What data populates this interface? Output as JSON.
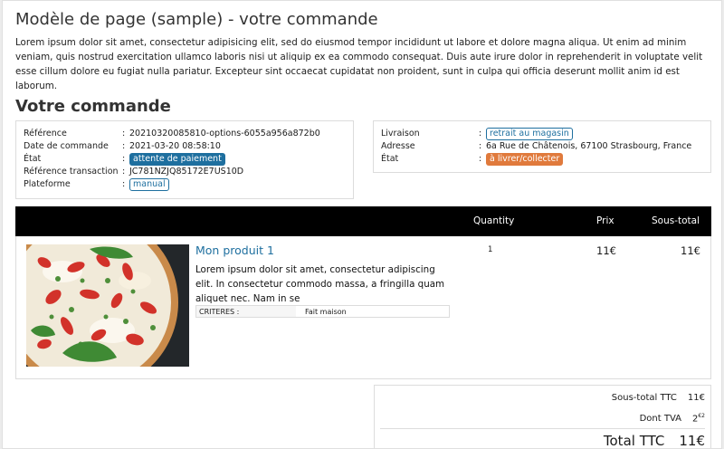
{
  "page": {
    "title": "Modèle de page (sample) - votre commande",
    "intro": "Lorem ipsum dolor sit amet, consectetur adipisicing elit, sed do eiusmod tempor incididunt ut labore et dolore magna aliqua. Ut enim ad minim veniam, quis nostrud exercitation ullamco laboris nisi ut aliquip ex ea commodo consequat. Duis aute irure dolor in reprehenderit in voluptate velit esse cillum dolore eu fugiat nulla pariatur. Excepteur sint occaecat cupidatat non proident, sunt in culpa qui officia deserunt mollit anim id est laborum."
  },
  "order": {
    "section_title": "Votre commande",
    "separator": ":",
    "left": {
      "reference_label": "Référence",
      "reference_value": "20210320085810-options-6055a956a872b0",
      "date_label": "Date de commande",
      "date_value": "2021-03-20 08:58:10",
      "state_label": "État",
      "state_value": "attente de paiement",
      "transaction_label": "Référence transaction",
      "transaction_value": "JC781NZJQ85172E7US10D",
      "platform_label": "Plateforme",
      "platform_value": "manual"
    },
    "right": {
      "delivery_label": "Livraison",
      "delivery_value": "retrait au magasin",
      "address_label": "Adresse",
      "address_value": "6a Rue de Châtenois, 67100 Strasbourg, France",
      "state_label": "État",
      "state_value": "à livrer/collecter"
    }
  },
  "table": {
    "headers": {
      "quantity": "Quantity",
      "price": "Prix",
      "subtotal": "Sous-total"
    },
    "items": [
      {
        "name": "Mon produit 1",
        "image_icon": "pizza-image",
        "description": "Lorem ipsum dolor sit amet, consectetur adipiscing elit. In consectetur commodo massa, a fringilla quam aliquet nec. Nam in se",
        "criteria_label": "CRITERES :",
        "criteria_value": "Fait maison",
        "quantity": "1",
        "price": "11€",
        "subtotal": "11€"
      }
    ]
  },
  "totals": {
    "subtotal_label": "Sous-total TTC",
    "subtotal_value": "11€",
    "tax_label": "Dont TVA",
    "tax_value": "2",
    "tax_value_cents": "€2",
    "total_label": "Total TTC",
    "total_value": "11€"
  },
  "colors": {
    "accent": "#1e6f9f",
    "state_pending": "#1e6f9f",
    "state_to_deliver": "#e07a3c",
    "table_header_bg": "#000000"
  }
}
